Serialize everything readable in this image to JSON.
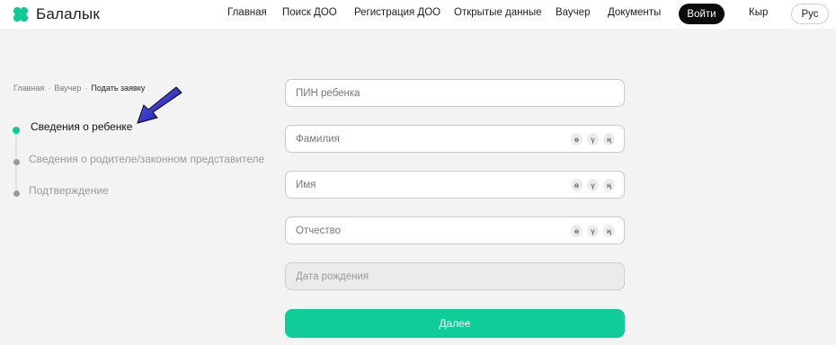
{
  "brand": {
    "name": "Балалык",
    "accent": "#11c996"
  },
  "nav": {
    "items": [
      "Главная",
      "Поиск ДОО",
      "Регистрация ДОО",
      "Открытые данные",
      "Ваучер",
      "Документы"
    ],
    "login_label": "Войти",
    "lang_kyr": "Кыр",
    "lang_rus": "Рус"
  },
  "breadcrumb": {
    "home": "Главная",
    "voucher": "Ваучер",
    "current": "Подать заявку",
    "separator": "·"
  },
  "steps": [
    {
      "label": "Сведения о ребенке",
      "active": true
    },
    {
      "label": "Сведения о родителе/законном представителе",
      "active": false
    },
    {
      "label": "Подтверждение",
      "active": false
    }
  ],
  "form": {
    "pin_placeholder": "ПИН ребенка",
    "surname_placeholder": "Фамилия",
    "name_placeholder": "Имя",
    "patronymic_placeholder": "Отчество",
    "birthdate_placeholder": "Дата рождения",
    "special_chars": [
      "ө",
      "ү",
      "ң"
    ],
    "submit_label": "Далее"
  },
  "annotation": {
    "arrow_icon": "arrow-pointer-icon",
    "arrow_color": "#1515c0"
  }
}
